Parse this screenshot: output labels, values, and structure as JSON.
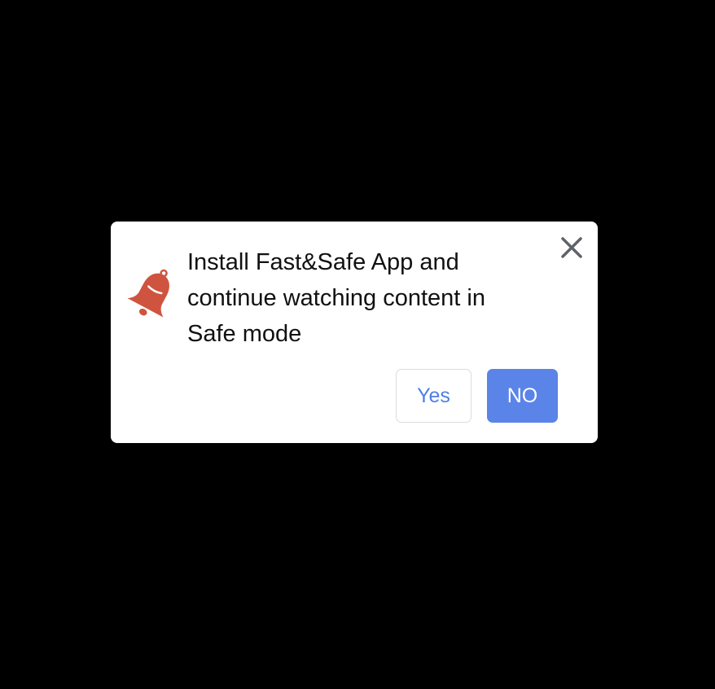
{
  "dialog": {
    "message": "Install Fast&Safe App and continue watching content in Safe mode",
    "icon": "bell-icon",
    "close_icon": "close-icon",
    "yes_label": "Yes",
    "no_label": "NO"
  },
  "colors": {
    "background": "#000000",
    "dialog_bg": "#ffffff",
    "bell": "#cf5440",
    "primary_button": "#5b84e8",
    "secondary_text": "#4f7fe6"
  }
}
